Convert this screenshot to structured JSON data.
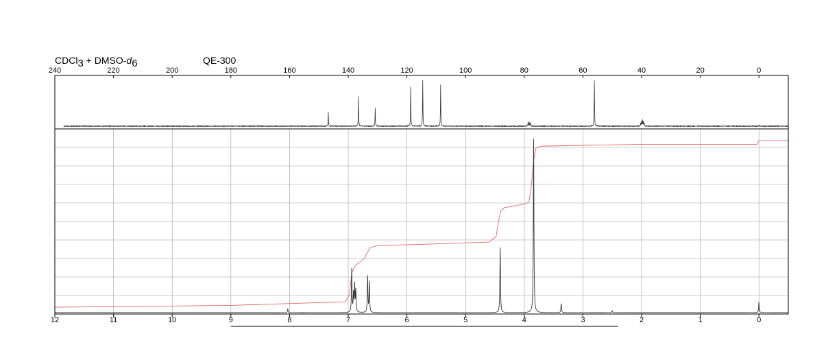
{
  "header": {
    "solvent_main": "CDCl",
    "solvent_sub1": "3",
    "solvent_mid": " + DMSO-",
    "solvent_italic": "d",
    "solvent_sub2": "6",
    "instrument": "QE-300"
  },
  "colors": {
    "spectrum": "#333333",
    "integral": "#e06666",
    "grid": "#9a9a9a",
    "axis": "#000000"
  },
  "chart_data": [
    {
      "type": "line",
      "name": "13C NMR spectrum",
      "x_axis": {
        "range": [
          240,
          -10
        ],
        "reversed": true,
        "ticks": [
          240,
          220,
          200,
          180,
          160,
          140,
          120,
          100,
          80,
          60,
          40,
          20,
          0
        ],
        "tick_labels": [
          "240",
          "220",
          "200",
          "180",
          "160",
          "140",
          "120",
          "100",
          "80",
          "60",
          "40",
          "20",
          "0"
        ],
        "position": "top"
      },
      "y_range": [
        0,
        1
      ],
      "grid": false,
      "baseline_from": 237,
      "peaks": [
        {
          "x": 146.8,
          "y": 0.28
        },
        {
          "x": 136.5,
          "y": 0.6
        },
        {
          "x": 130.8,
          "y": 0.37
        },
        {
          "x": 118.7,
          "y": 0.8
        },
        {
          "x": 114.6,
          "y": 0.93
        },
        {
          "x": 108.5,
          "y": 0.84
        },
        {
          "x": 78.7,
          "y": 0.08
        },
        {
          "x": 78.3,
          "y": 0.08
        },
        {
          "x": 77.9,
          "y": 0.08
        },
        {
          "x": 56.1,
          "y": 0.93
        },
        {
          "x": 40.3,
          "y": 0.06
        },
        {
          "x": 40.0,
          "y": 0.1
        },
        {
          "x": 39.7,
          "y": 0.12
        },
        {
          "x": 39.4,
          "y": 0.1
        },
        {
          "x": 39.1,
          "y": 0.06
        },
        {
          "x": 0.0,
          "y": 0.02
        }
      ]
    },
    {
      "type": "line",
      "name": "1H NMR spectrum",
      "x_axis": {
        "range": [
          12,
          -0.5
        ],
        "reversed": true,
        "ticks": [
          12,
          11,
          10,
          9,
          8,
          7,
          6,
          5,
          4,
          3,
          2,
          1,
          0
        ],
        "tick_labels": [
          "12",
          "11",
          "10",
          "9",
          "8",
          "7",
          "6",
          "5",
          "4",
          "3",
          "2",
          "1",
          "0"
        ],
        "position": "bottom"
      },
      "y_range": [
        0,
        1
      ],
      "grid": true,
      "peaks": [
        {
          "x": 8.03,
          "y": 0.02
        },
        {
          "x": 6.94,
          "y": 0.24
        },
        {
          "x": 6.91,
          "y": 0.1
        },
        {
          "x": 6.89,
          "y": 0.15
        },
        {
          "x": 6.87,
          "y": 0.12
        },
        {
          "x": 6.67,
          "y": 0.2
        },
        {
          "x": 6.64,
          "y": 0.17
        },
        {
          "x": 4.41,
          "y": 0.36
        },
        {
          "x": 3.84,
          "y": 0.96
        },
        {
          "x": 3.37,
          "y": 0.05
        },
        {
          "x": 2.5,
          "y": 0.01
        },
        {
          "x": 0.0,
          "y": 0.06
        }
      ],
      "integral": [
        [
          12.0,
          0.03
        ],
        [
          9.0,
          0.04
        ],
        [
          7.05,
          0.06
        ],
        [
          6.98,
          0.1
        ],
        [
          6.94,
          0.22
        ],
        [
          6.88,
          0.26
        ],
        [
          6.8,
          0.28
        ],
        [
          6.72,
          0.3
        ],
        [
          6.68,
          0.33
        ],
        [
          6.62,
          0.36
        ],
        [
          6.5,
          0.37
        ],
        [
          5.5,
          0.38
        ],
        [
          4.6,
          0.39
        ],
        [
          4.48,
          0.42
        ],
        [
          4.44,
          0.5
        ],
        [
          4.4,
          0.56
        ],
        [
          4.34,
          0.58
        ],
        [
          4.0,
          0.6
        ],
        [
          3.92,
          0.61
        ],
        [
          3.88,
          0.7
        ],
        [
          3.84,
          0.84
        ],
        [
          3.8,
          0.91
        ],
        [
          3.7,
          0.92
        ],
        [
          2.0,
          0.93
        ],
        [
          0.03,
          0.93
        ],
        [
          0.0,
          0.95
        ],
        [
          -0.5,
          0.95
        ]
      ],
      "bracket": {
        "from": 9.0,
        "to": 2.4
      }
    }
  ]
}
